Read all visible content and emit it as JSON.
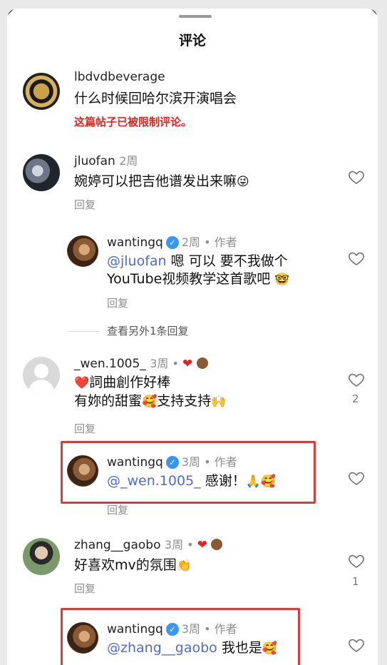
{
  "header": {
    "title": "评论"
  },
  "comments": [
    {
      "username": "lbdvdbeverage",
      "text": "什么时候回哈尔滨开演唱会",
      "restricted_notice": "这篇帖子已被限制评论。"
    },
    {
      "username": "jluofan",
      "time": "2周",
      "text": "婉婷可以把吉他谱发出来嘛",
      "emoji": "😜",
      "reply_label": "回复",
      "replies": [
        {
          "username": "wantingq",
          "time": "2周",
          "author_label": "作者",
          "mention": "@jluofan",
          "text_line1": " 嗯 可以 要不我做个",
          "text_line2": "YouTube视频教学这首歌吧",
          "emoji": "🤓",
          "reply_label": "回复"
        }
      ],
      "view_more": "查看另外1条回复"
    },
    {
      "username": "_wen.1005_",
      "time": "3周",
      "text_line1": "詞曲創作好棒",
      "text_line2_a": "有妳的甜蜜",
      "text_line2_b": "支持支持",
      "emoji_heart": "❤️",
      "emoji_face": "🥰",
      "emoji_hands": "🙌",
      "like_count": "2",
      "reply_label": "回复",
      "replies": [
        {
          "username": "wantingq",
          "time": "3周",
          "author_label": "作者",
          "mention": "@_wen.1005_",
          "text": " 感谢！",
          "emoji": "🙏🥰",
          "reply_label": "回复"
        }
      ]
    },
    {
      "username": "zhang__gaobo",
      "time": "3周",
      "text": "好喜欢mv的氛围",
      "emoji": "👏",
      "like_count": "1",
      "reply_label": "回复",
      "replies": [
        {
          "username": "wantingq",
          "time": "3周",
          "author_label": "作者",
          "mention": "@zhang__gaobo",
          "text": " 我也是",
          "emoji": "🥰"
        }
      ]
    }
  ],
  "icons": {
    "like": "heart-outline-icon",
    "verified": "verified-badge-icon"
  },
  "colors": {
    "restricted": "#e0261f",
    "mention": "#4f6bd8",
    "highlight": "#d83d3d",
    "verified": "#3897f0"
  }
}
